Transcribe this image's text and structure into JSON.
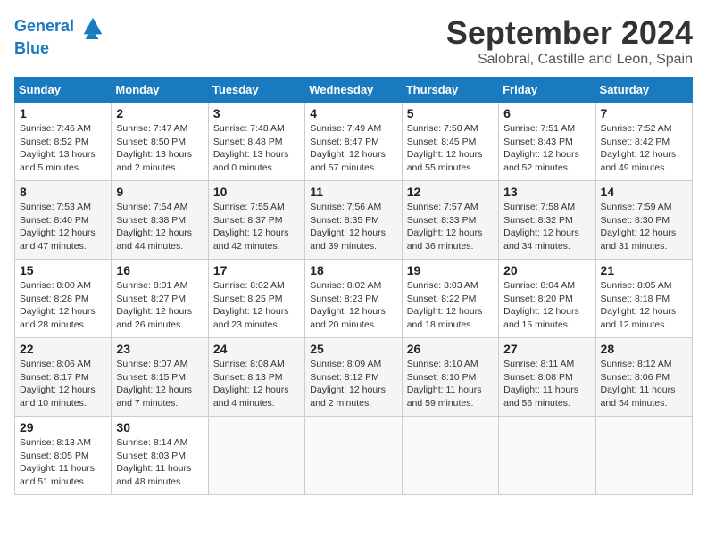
{
  "header": {
    "logo_line1": "General",
    "logo_line2": "Blue",
    "month": "September 2024",
    "location": "Salobral, Castille and Leon, Spain"
  },
  "weekdays": [
    "Sunday",
    "Monday",
    "Tuesday",
    "Wednesday",
    "Thursday",
    "Friday",
    "Saturday"
  ],
  "weeks": [
    [
      {
        "day": "1",
        "sunrise": "7:46 AM",
        "sunset": "8:52 PM",
        "daylight": "13 hours and 5 minutes."
      },
      {
        "day": "2",
        "sunrise": "7:47 AM",
        "sunset": "8:50 PM",
        "daylight": "13 hours and 2 minutes."
      },
      {
        "day": "3",
        "sunrise": "7:48 AM",
        "sunset": "8:48 PM",
        "daylight": "13 hours and 0 minutes."
      },
      {
        "day": "4",
        "sunrise": "7:49 AM",
        "sunset": "8:47 PM",
        "daylight": "12 hours and 57 minutes."
      },
      {
        "day": "5",
        "sunrise": "7:50 AM",
        "sunset": "8:45 PM",
        "daylight": "12 hours and 55 minutes."
      },
      {
        "day": "6",
        "sunrise": "7:51 AM",
        "sunset": "8:43 PM",
        "daylight": "12 hours and 52 minutes."
      },
      {
        "day": "7",
        "sunrise": "7:52 AM",
        "sunset": "8:42 PM",
        "daylight": "12 hours and 49 minutes."
      }
    ],
    [
      {
        "day": "8",
        "sunrise": "7:53 AM",
        "sunset": "8:40 PM",
        "daylight": "12 hours and 47 minutes."
      },
      {
        "day": "9",
        "sunrise": "7:54 AM",
        "sunset": "8:38 PM",
        "daylight": "12 hours and 44 minutes."
      },
      {
        "day": "10",
        "sunrise": "7:55 AM",
        "sunset": "8:37 PM",
        "daylight": "12 hours and 42 minutes."
      },
      {
        "day": "11",
        "sunrise": "7:56 AM",
        "sunset": "8:35 PM",
        "daylight": "12 hours and 39 minutes."
      },
      {
        "day": "12",
        "sunrise": "7:57 AM",
        "sunset": "8:33 PM",
        "daylight": "12 hours and 36 minutes."
      },
      {
        "day": "13",
        "sunrise": "7:58 AM",
        "sunset": "8:32 PM",
        "daylight": "12 hours and 34 minutes."
      },
      {
        "day": "14",
        "sunrise": "7:59 AM",
        "sunset": "8:30 PM",
        "daylight": "12 hours and 31 minutes."
      }
    ],
    [
      {
        "day": "15",
        "sunrise": "8:00 AM",
        "sunset": "8:28 PM",
        "daylight": "12 hours and 28 minutes."
      },
      {
        "day": "16",
        "sunrise": "8:01 AM",
        "sunset": "8:27 PM",
        "daylight": "12 hours and 26 minutes."
      },
      {
        "day": "17",
        "sunrise": "8:02 AM",
        "sunset": "8:25 PM",
        "daylight": "12 hours and 23 minutes."
      },
      {
        "day": "18",
        "sunrise": "8:02 AM",
        "sunset": "8:23 PM",
        "daylight": "12 hours and 20 minutes."
      },
      {
        "day": "19",
        "sunrise": "8:03 AM",
        "sunset": "8:22 PM",
        "daylight": "12 hours and 18 minutes."
      },
      {
        "day": "20",
        "sunrise": "8:04 AM",
        "sunset": "8:20 PM",
        "daylight": "12 hours and 15 minutes."
      },
      {
        "day": "21",
        "sunrise": "8:05 AM",
        "sunset": "8:18 PM",
        "daylight": "12 hours and 12 minutes."
      }
    ],
    [
      {
        "day": "22",
        "sunrise": "8:06 AM",
        "sunset": "8:17 PM",
        "daylight": "12 hours and 10 minutes."
      },
      {
        "day": "23",
        "sunrise": "8:07 AM",
        "sunset": "8:15 PM",
        "daylight": "12 hours and 7 minutes."
      },
      {
        "day": "24",
        "sunrise": "8:08 AM",
        "sunset": "8:13 PM",
        "daylight": "12 hours and 4 minutes."
      },
      {
        "day": "25",
        "sunrise": "8:09 AM",
        "sunset": "8:12 PM",
        "daylight": "12 hours and 2 minutes."
      },
      {
        "day": "26",
        "sunrise": "8:10 AM",
        "sunset": "8:10 PM",
        "daylight": "11 hours and 59 minutes."
      },
      {
        "day": "27",
        "sunrise": "8:11 AM",
        "sunset": "8:08 PM",
        "daylight": "11 hours and 56 minutes."
      },
      {
        "day": "28",
        "sunrise": "8:12 AM",
        "sunset": "8:06 PM",
        "daylight": "11 hours and 54 minutes."
      }
    ],
    [
      {
        "day": "29",
        "sunrise": "8:13 AM",
        "sunset": "8:05 PM",
        "daylight": "11 hours and 51 minutes."
      },
      {
        "day": "30",
        "sunrise": "8:14 AM",
        "sunset": "8:03 PM",
        "daylight": "11 hours and 48 minutes."
      },
      null,
      null,
      null,
      null,
      null
    ]
  ]
}
